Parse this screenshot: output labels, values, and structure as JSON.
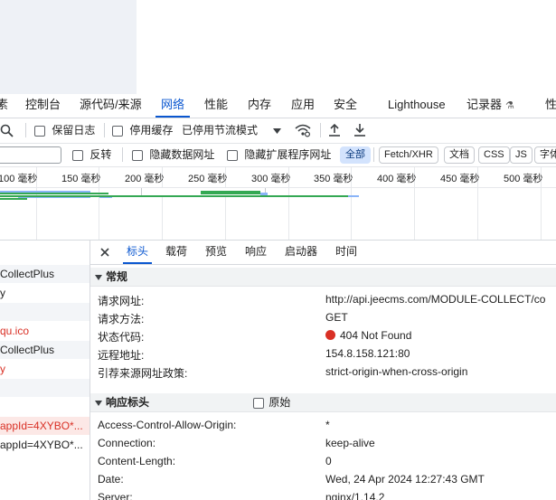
{
  "main_tabs": [
    {
      "label": "素"
    },
    {
      "label": "控制台"
    },
    {
      "label": "源代码/来源"
    },
    {
      "label": "网络"
    },
    {
      "label": "性能"
    },
    {
      "label": "内存"
    },
    {
      "label": "应用"
    },
    {
      "label": "安全"
    },
    {
      "label": "Lighthouse"
    },
    {
      "label": "记录器"
    },
    {
      "label": "性"
    }
  ],
  "toolbar": {
    "preserve_log": "保留日志",
    "disable_cache": "停用缓存",
    "throttle": "已停用节流模式"
  },
  "filter": {
    "invert": "反转",
    "hide_data_urls": "隐藏数据网址",
    "hide_ext_urls": "隐藏扩展程序网址",
    "types": [
      "全部",
      "Fetch/XHR",
      "文档",
      "CSS",
      "JS",
      "字体"
    ]
  },
  "timeline": {
    "ticks": [
      "100 毫秒",
      "150 毫秒",
      "200 毫秒",
      "250 毫秒",
      "300 毫秒",
      "350 毫秒",
      "400 毫秒",
      "450 毫秒",
      "500 毫秒"
    ]
  },
  "requests": [
    {
      "name": "CollectPlus"
    },
    {
      "name": "y"
    },
    {
      "name": ""
    },
    {
      "name": "qu.ico"
    },
    {
      "name": "CollectPlus"
    },
    {
      "name": "y"
    },
    {
      "name": ""
    },
    {
      "name": "appId=4XYBO*..."
    },
    {
      "name": "appId=4XYBO*..."
    }
  ],
  "detail_tabs": [
    "标头",
    "载荷",
    "预览",
    "响应",
    "启动器",
    "时间"
  ],
  "general": {
    "title": "常规",
    "rows": [
      {
        "k": "请求网址:",
        "v": "http://api.jeecms.com/MODULE-COLLECT/co"
      },
      {
        "k": "请求方法:",
        "v": "GET"
      },
      {
        "k": "状态代码:",
        "v": "404 Not Found"
      },
      {
        "k": "远程地址:",
        "v": "154.8.158.121:80"
      },
      {
        "k": "引荐来源网址政策:",
        "v": "strict-origin-when-cross-origin"
      }
    ]
  },
  "response_headers": {
    "title": "响应标头",
    "raw_label": "原始",
    "rows": [
      {
        "k": "Access-Control-Allow-Origin:",
        "v": "*"
      },
      {
        "k": "Connection:",
        "v": "keep-alive"
      },
      {
        "k": "Content-Length:",
        "v": "0"
      },
      {
        "k": "Date:",
        "v": "Wed, 24 Apr 2024 12:27:43 GMT"
      },
      {
        "k": "Server:",
        "v": "nginx/1.14.2"
      }
    ]
  },
  "colors": {
    "accent": "#0b57d0",
    "error": "#d93025",
    "waterfall_green": "#34a853",
    "waterfall_blue": "#8ab4f8"
  }
}
